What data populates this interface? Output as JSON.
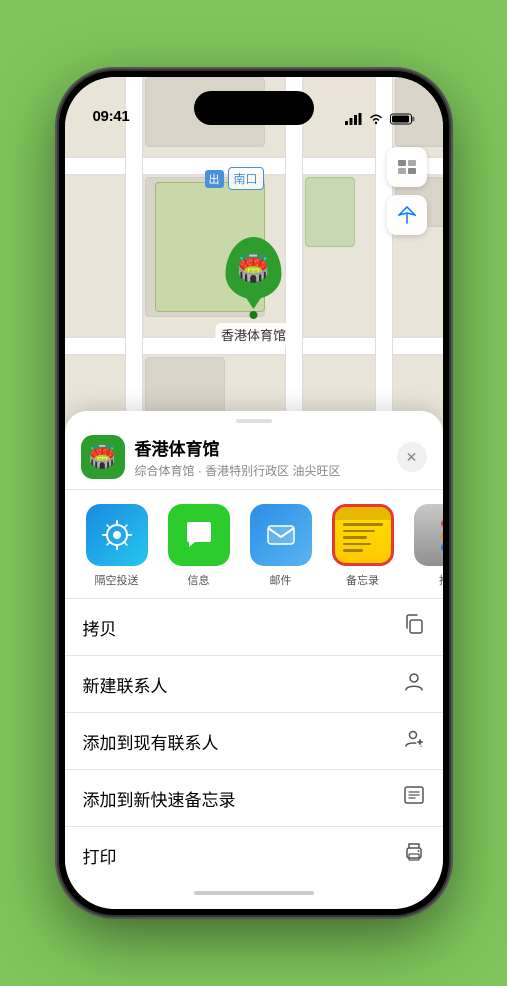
{
  "status_bar": {
    "time": "09:41",
    "location_arrow": true
  },
  "map": {
    "label_text": "南口",
    "label_prefix": "出"
  },
  "venue_marker": {
    "label": "香港体育馆"
  },
  "venue_header": {
    "name": "香港体育馆",
    "description": "综合体育馆 · 香港特别行政区 油尖旺区",
    "close_label": "✕"
  },
  "share_actions": [
    {
      "id": "airdrop",
      "label": "隔空投送",
      "type": "airdrop"
    },
    {
      "id": "message",
      "label": "信息",
      "type": "message"
    },
    {
      "id": "mail",
      "label": "邮件",
      "type": "mail"
    },
    {
      "id": "notes",
      "label": "备忘录",
      "type": "notes"
    },
    {
      "id": "more",
      "label": "推",
      "type": "more"
    }
  ],
  "action_items": [
    {
      "id": "copy",
      "label": "拷贝",
      "icon": "copy"
    },
    {
      "id": "new-contact",
      "label": "新建联系人",
      "icon": "person"
    },
    {
      "id": "add-existing",
      "label": "添加到现有联系人",
      "icon": "person-add"
    },
    {
      "id": "quick-note",
      "label": "添加到新快速备忘录",
      "icon": "quick-note"
    },
    {
      "id": "print",
      "label": "打印",
      "icon": "print"
    }
  ],
  "home_indicator": ""
}
